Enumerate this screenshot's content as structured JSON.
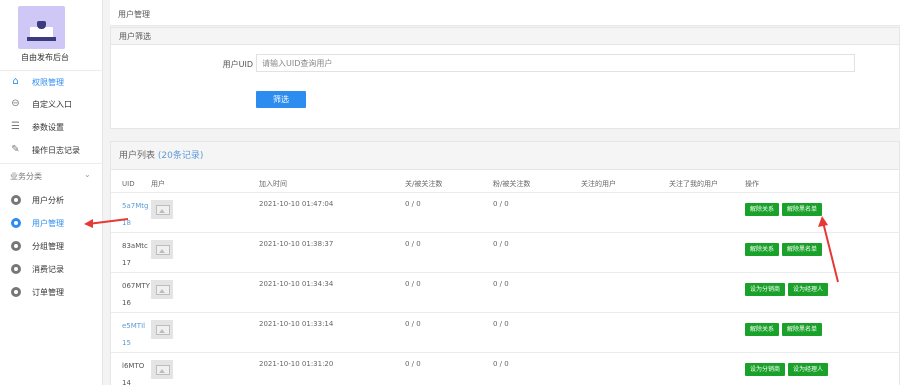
{
  "sidebar": {
    "brand": "自由发布后台",
    "items": [
      {
        "label": "权限管理",
        "icon": "home-icon",
        "active": true
      },
      {
        "label": "自定义入口",
        "icon": "minus-circle-icon",
        "active": false
      },
      {
        "label": "参数设置",
        "icon": "list-icon",
        "active": false
      },
      {
        "label": "操作日志记录",
        "icon": "edit-icon",
        "active": false
      }
    ],
    "section": "业务分类",
    "section_items": [
      {
        "label": "用户分析",
        "icon": "gear-icon",
        "active": false
      },
      {
        "label": "用户管理",
        "icon": "gear-icon",
        "active": true
      },
      {
        "label": "分组管理",
        "icon": "gear-icon",
        "active": false
      },
      {
        "label": "消费记录",
        "icon": "gear-icon",
        "active": false
      },
      {
        "label": "订单管理",
        "icon": "gear-icon",
        "active": false
      }
    ]
  },
  "breadcrumb": "用户管理",
  "filter": {
    "panel_title": "用户筛选",
    "uid_label": "用户UID",
    "uid_placeholder": "请输入UID查询用户",
    "submit_label": "筛选"
  },
  "list": {
    "title": "用户列表",
    "count": "(20条记录)",
    "columns": [
      "UID",
      "用户",
      "加入时间",
      "关/被关注数",
      "粉/被关注数",
      "关注的用户",
      "关注了我的用户",
      "操作"
    ],
    "rows": [
      {
        "uid": "5a7Mtg",
        "uid2": "18",
        "time": "2021-10-10 01:47:04",
        "c1": "0 / 0",
        "c2": "0 / 0",
        "ops": [
          "解除关系",
          "解除黑名单"
        ],
        "link": true
      },
      {
        "uid": "83aMtc",
        "uid2": "17",
        "time": "2021-10-10 01:38:37",
        "c1": "0 / 0",
        "c2": "0 / 0",
        "ops": [
          "解除关系",
          "解除黑名单"
        ],
        "link": false
      },
      {
        "uid": "067MTY",
        "uid2": "16",
        "time": "2021-10-10 01:34:34",
        "c1": "0 / 0",
        "c2": "0 / 0",
        "ops": [
          "设为分销商",
          "设为经理人"
        ],
        "link": false
      },
      {
        "uid": "e5MTIl",
        "uid2": "15",
        "time": "2021-10-10 01:33:14",
        "c1": "0 / 0",
        "c2": "0 / 0",
        "ops": [
          "解除关系",
          "解除黑名单"
        ],
        "link": true
      },
      {
        "uid": "l6MTO",
        "uid2": "14",
        "time": "2021-10-10 01:31:20",
        "c1": "0 / 0",
        "c2": "0 / 0",
        "ops": [
          "设为分销商",
          "设为经理人"
        ],
        "link": false
      }
    ]
  },
  "colors": {
    "accent": "#2d8cf0",
    "action_green": "#19a12a",
    "annotation_red": "#e53935"
  }
}
